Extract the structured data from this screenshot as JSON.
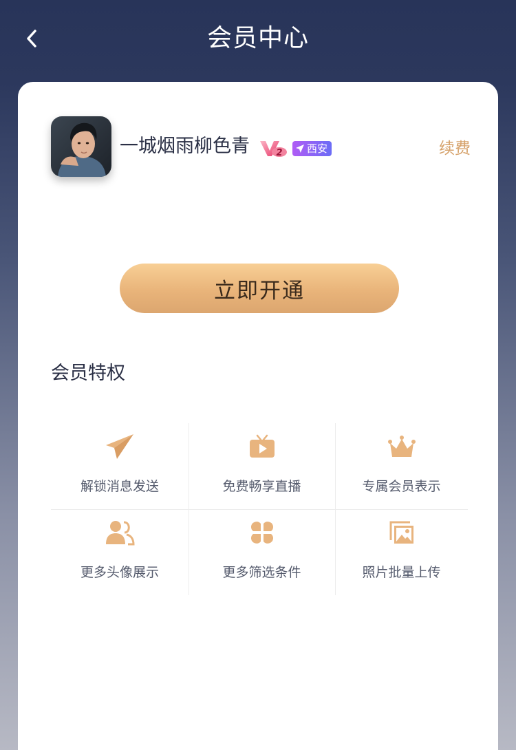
{
  "header": {
    "title": "会员中心"
  },
  "profile": {
    "username": "一城烟雨柳色青",
    "vip_level": "2",
    "location": "西安",
    "renew_label": "续费"
  },
  "action": {
    "open_label": "立即开通"
  },
  "privileges": {
    "title": "会员特权",
    "items": [
      {
        "label": "解锁消息发送",
        "icon": "paper-plane-icon"
      },
      {
        "label": "免费畅享直播",
        "icon": "tv-play-icon"
      },
      {
        "label": "专属会员表示",
        "icon": "crown-icon"
      },
      {
        "label": "更多头像展示",
        "icon": "users-icon"
      },
      {
        "label": "更多筛选条件",
        "icon": "clover-filter-icon"
      },
      {
        "label": "照片批量上传",
        "icon": "photos-icon"
      }
    ]
  },
  "colors": {
    "accent_gold": "#d6a26b",
    "icon_gold": "#e8b47e",
    "nav_bg": "#283459",
    "location_badge": "#8f63f5"
  }
}
